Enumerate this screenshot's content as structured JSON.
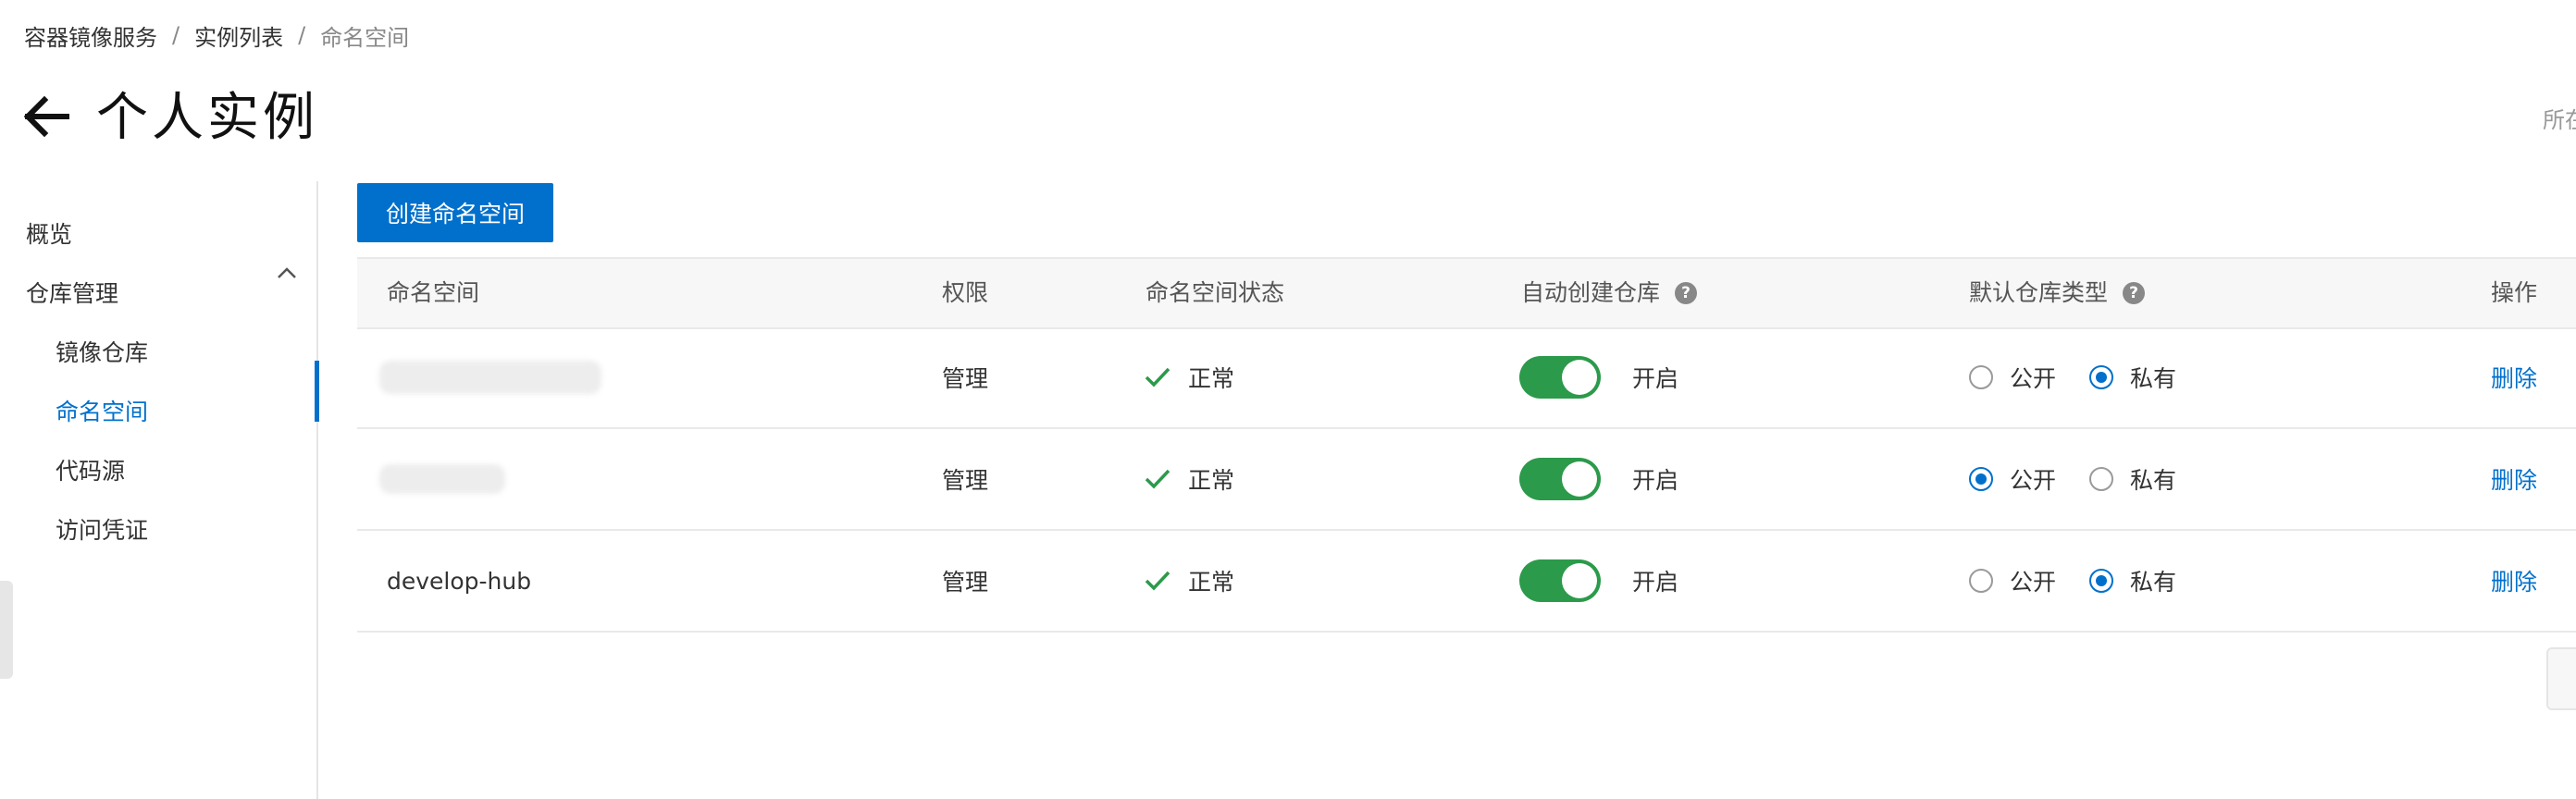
{
  "breadcrumb": {
    "items": [
      "容器镜像服务",
      "实例列表",
      "命名空间"
    ],
    "separator": "/"
  },
  "header": {
    "title": "个人实例",
    "back_icon": "arrow-left-icon",
    "region_text": "所在"
  },
  "sidebar": {
    "overview": "概览",
    "repo_group": "仓库管理",
    "repo_group_icon": "chevron-up-icon",
    "sub_items": [
      "镜像仓库",
      "命名空间",
      "代码源"
    ],
    "credentials": "访问凭证",
    "active_item": "命名空间"
  },
  "toolbar": {
    "create_button": "创建命名空间"
  },
  "table": {
    "columns": [
      "命名空间",
      "权限",
      "命名空间状态",
      "自动创建仓库",
      "默认仓库类型",
      "操作"
    ],
    "help_glyph": "?",
    "rows": [
      {
        "namespace": "",
        "permission": "管理",
        "status": "正常",
        "auto_create": true,
        "auto_create_label": "开启",
        "visibility": "私有",
        "public_label": "公开",
        "private_label": "私有",
        "action": "删除"
      },
      {
        "namespace": "",
        "permission": "管理",
        "status": "正常",
        "auto_create": true,
        "auto_create_label": "开启",
        "visibility": "公开",
        "public_label": "公开",
        "private_label": "私有",
        "action": "删除"
      },
      {
        "namespace": "develop-hub",
        "permission": "管理",
        "status": "正常",
        "auto_create": true,
        "auto_create_label": "开启",
        "visibility": "私有",
        "public_label": "公开",
        "private_label": "私有",
        "action": "删除"
      }
    ]
  },
  "colors": {
    "accent": "#0070cc",
    "toggle_on": "#2b9a4a",
    "status_ok": "#2b9a4a",
    "header_bg": "#f7f7f7"
  }
}
